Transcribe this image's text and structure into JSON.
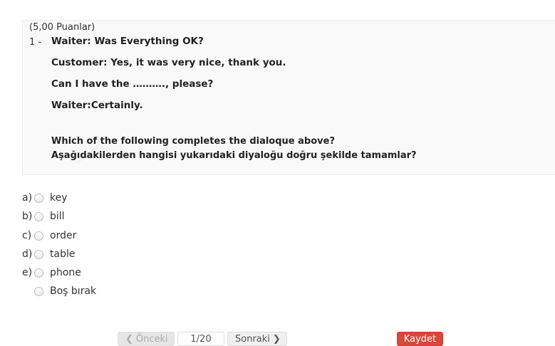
{
  "question": {
    "points": "(5,00 Puanlar)",
    "number": "1 -",
    "lines": [
      "Waiter: Was Everything OK?",
      "Customer: Yes, it was very nice, thank you.",
      "Can I have the ………., please?",
      "Waiter:Certainly.",
      "Which of the following completes the dialoque above?",
      "Aşağıdakilerden hangisi yukarıdaki diyaloğu doğru şekilde tamamlar?"
    ]
  },
  "options": [
    {
      "letter": "a)",
      "text": "key"
    },
    {
      "letter": "b)",
      "text": "bill"
    },
    {
      "letter": "c)",
      "text": "order"
    },
    {
      "letter": "d)",
      "text": "table"
    },
    {
      "letter": "e)",
      "text": "phone"
    },
    {
      "letter": "",
      "text": "Boş bırak"
    }
  ],
  "nav": {
    "prev_label": "Önceki",
    "page_indicator": "1/20",
    "next_label": "Sonraki",
    "save_label": "Kaydet"
  }
}
